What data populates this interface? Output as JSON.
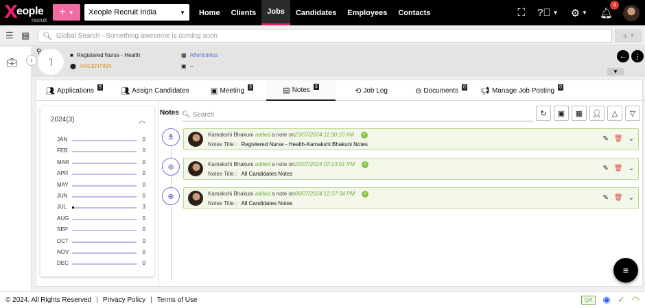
{
  "brand": {
    "logo_x": "X",
    "logo_name": "eople",
    "logo_sub": "recruit"
  },
  "topnav": {
    "plus": "+",
    "company": "Xeople Recruit India",
    "links": [
      "Home",
      "Clients",
      "Jobs",
      "Candidates",
      "Employees",
      "Contacts"
    ],
    "active_link": "Jobs",
    "notification_count": "4"
  },
  "search": {
    "placeholder": "Global Search - Something awesome is coming soon",
    "add": "+"
  },
  "job": {
    "avatar_initial": "']",
    "title": "Registered Nurse - Health",
    "location": "ARGENTINA",
    "client": "Affortclinics",
    "contact": "--"
  },
  "tabs": [
    {
      "label": "Applications",
      "count": "9",
      "icon": "users-icon"
    },
    {
      "label": "Assign Candidates",
      "count": "",
      "icon": "assign-users-icon"
    },
    {
      "label": "Meeting",
      "count": "3",
      "icon": "meeting-icon"
    },
    {
      "label": "Notes",
      "count": "3",
      "icon": "notes-icon"
    },
    {
      "label": "Job Log",
      "count": "",
      "icon": "history-icon"
    },
    {
      "label": "Documents",
      "count": "0",
      "icon": "documents-icon"
    },
    {
      "label": "Manage Job Posting",
      "count": "0",
      "icon": "megaphone-icon"
    }
  ],
  "calendar": {
    "year_label": "2024(3)",
    "months": [
      {
        "m": "JAN",
        "c": "0"
      },
      {
        "m": "FEB",
        "c": "0"
      },
      {
        "m": "MAR",
        "c": "0"
      },
      {
        "m": "APR",
        "c": "0"
      },
      {
        "m": "MAY",
        "c": "0"
      },
      {
        "m": "JUN",
        "c": "0"
      },
      {
        "m": "JUL",
        "c": "3"
      },
      {
        "m": "AUG",
        "c": "0"
      },
      {
        "m": "SEP",
        "c": "0"
      },
      {
        "m": "OCT",
        "c": "0"
      },
      {
        "m": "NOV",
        "c": "0"
      },
      {
        "m": "DEC",
        "c": "0"
      }
    ]
  },
  "notes": {
    "label": "Notes",
    "search_placeholder": "Search",
    "items": [
      {
        "author": "Kamakshi Bhakuni",
        "action": "added",
        "mid": "a note on",
        "datetime": "23/07/2024 11:30:10 AM",
        "title_label": "Notes Title :",
        "title": "Registered Nurse - Health-Kamakshi Bhakuni Notes",
        "type_icon": "accessibility-icon"
      },
      {
        "author": "Kamakshi Bhakuni",
        "action": "added",
        "mid": "a note on",
        "datetime": "22/07/2024 07:13:01 PM",
        "title_label": "Notes Title :",
        "title": "All Candidates Notes",
        "type_icon": "add-circle-icon"
      },
      {
        "author": "Kamakshi Bhakuni",
        "action": "added",
        "mid": "a note on",
        "datetime": "08/07/2024 12:37:34 PM",
        "title_label": "Notes Title :",
        "title": "All Candidates Notes",
        "type_icon": "add-circle-icon"
      }
    ]
  },
  "footer": {
    "copyright": "© 2024. All Rights Reserved",
    "privacy": "Privacy Policy",
    "terms": "Terms of Use",
    "env": "QA"
  }
}
